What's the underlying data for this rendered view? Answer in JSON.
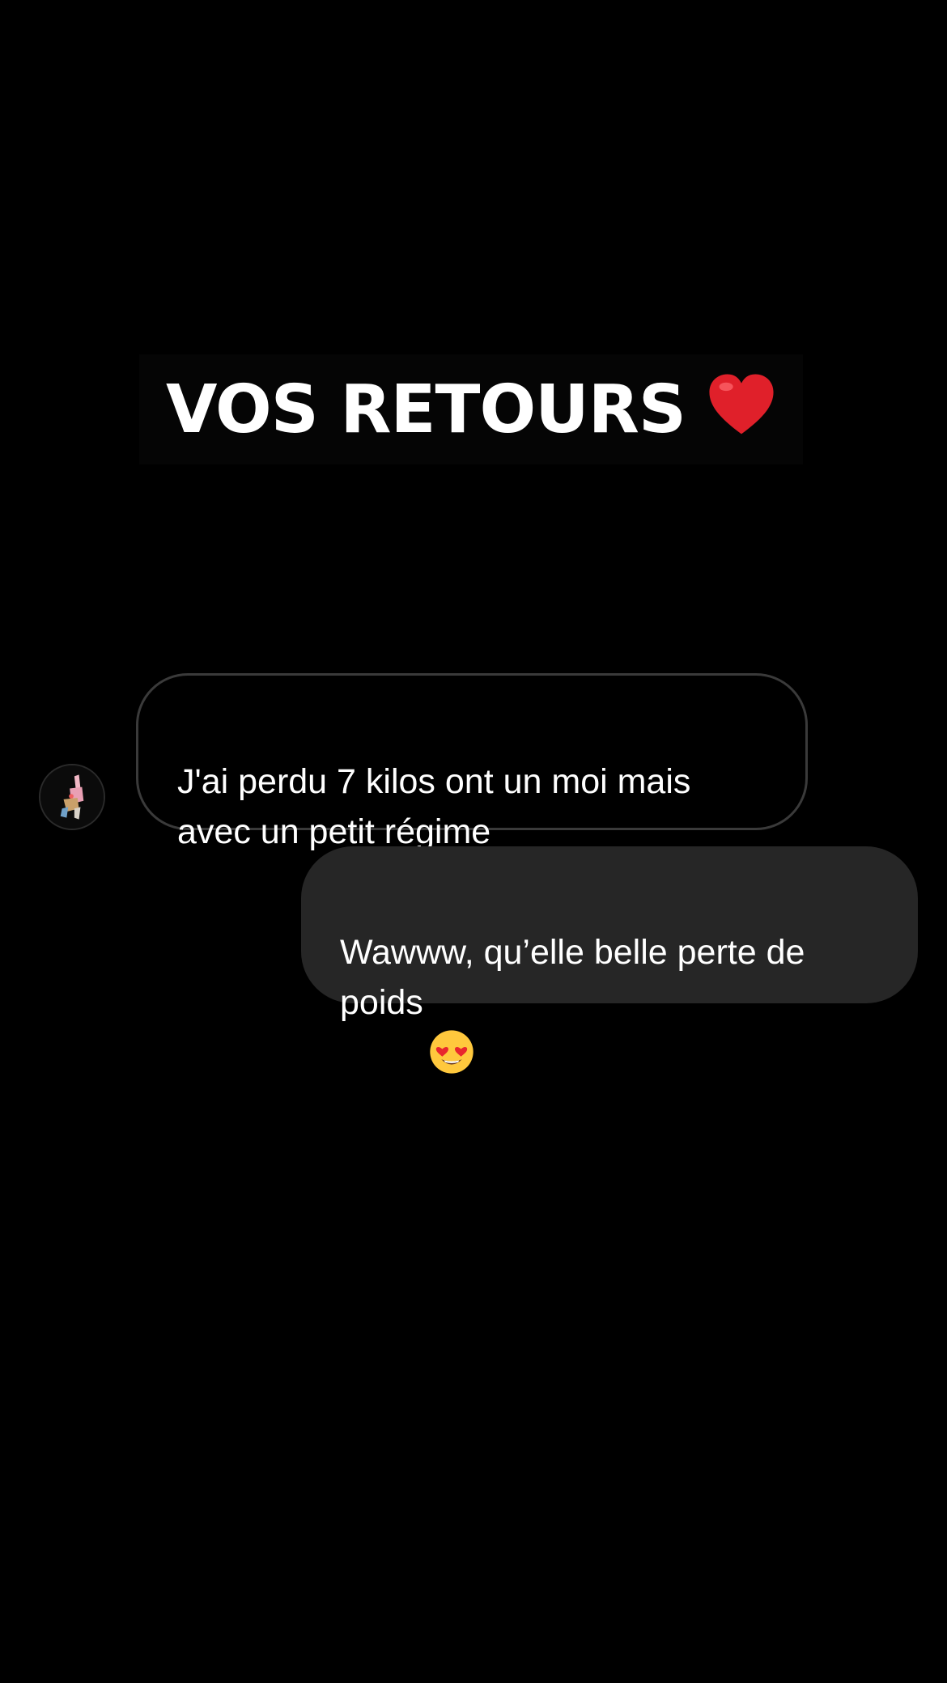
{
  "title": {
    "text": "VOS RETOURS",
    "emoji_icon": "red-heart-icon"
  },
  "conversation": {
    "received": {
      "avatar_icon": "user-avatar-icon",
      "text": "J'ai perdu 7 kilos ont un moi mais\navec un petit régime"
    },
    "sent": {
      "text": "Wawww, qu’elle belle perte de\npoids",
      "emoji_icon": "smiling-face-with-heart-eyes-icon"
    }
  },
  "colors": {
    "background": "#000000",
    "received_bubble_border": "#3a3a3a",
    "sent_bubble": "#262626",
    "heart": "#e0202a",
    "emoji_face": "#ffc83d"
  }
}
